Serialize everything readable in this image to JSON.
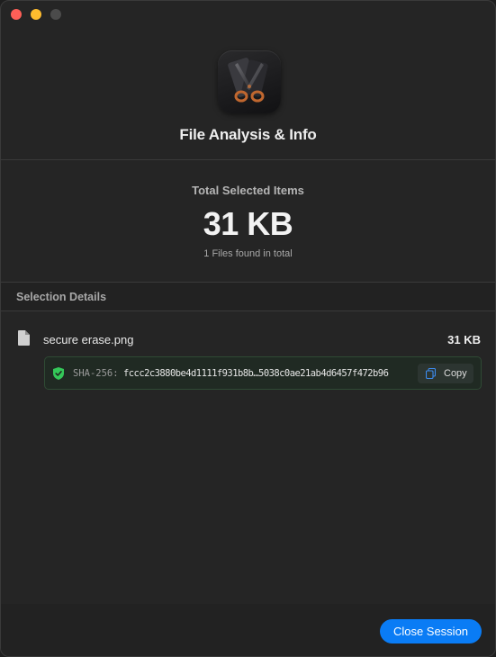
{
  "window": {
    "title": "File Analysis & Info",
    "traffic_lights": {
      "close_color": "#fe5f57",
      "minimize_color": "#febc2e",
      "maximize_color": "#4b4b4b"
    },
    "app_icon": "scissors-app-icon"
  },
  "summary": {
    "label": "Total Selected Items",
    "total_size": "31 KB",
    "count_text": "1 Files found in total"
  },
  "details": {
    "header": "Selection Details",
    "files": [
      {
        "name": "secure erase.png",
        "size": "31 KB",
        "icon": "document-icon",
        "hash_label": "SHA-256:",
        "hash_value": "fccc2c3880be4d1111f931b8b…5038c0ae21ab4d6457f472b96",
        "hash_verified_icon": "shield-check-icon",
        "copy_label": "Copy",
        "copy_icon": "clipboard-icon"
      }
    ]
  },
  "footer": {
    "close_label": "Close Session",
    "accent_color": "#0a7cf5"
  }
}
